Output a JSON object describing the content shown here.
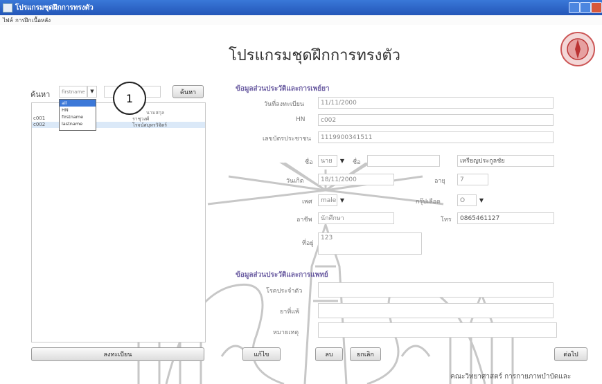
{
  "window": {
    "title": "โปรแกรมชุดฝึกการทรงตัว"
  },
  "menu": [
    "ไฟล์",
    "การฝึก",
    "เนื้อหลัง"
  ],
  "page_title": "โปรแกรมชุดฝึกการทรงตัว",
  "search": {
    "label": "ค้นหา",
    "select_value": "firstname",
    "button": "ค้นหา",
    "options": [
      "all",
      "HN",
      "firstname",
      "lastname"
    ],
    "selected_index": 0
  },
  "results": {
    "header_right": "นามสกุล",
    "rows": [
      {
        "id": "c001",
        "col2": "ราชุวงศ์"
      },
      {
        "id": "c002",
        "col2": "โรจน์สมุทรวิจิตร์"
      }
    ]
  },
  "callout": "1",
  "patient_section": {
    "heading": "ข้อมูลส่วนประวัติและการเพย์ยา",
    "fields": [
      {
        "label": "วันที่ลงทะเบียน",
        "value": "11/11/2000"
      },
      {
        "label": "HN",
        "value": "c002"
      },
      {
        "label": "เลขบัตรประชาชน",
        "value": "1119900341511"
      },
      {
        "label": "ชื่อ",
        "value": "นาย"
      },
      {
        "label": "วันเกิด",
        "value": "18/11/2000"
      },
      {
        "label": "เพศ",
        "value": "male"
      },
      {
        "label": "อาชีพ",
        "value": "นักศึกษา"
      },
      {
        "label": "ที่อยู่",
        "value": "123"
      }
    ],
    "name_sub_label": "นามสกุล",
    "lastname_value": "เหรียญประกูลชัย",
    "age_label": "อายุ",
    "age_value": "7",
    "blood_label": "กรุ๊ปเลือด",
    "blood_value": "O",
    "phone_label": "โทร",
    "phone_value": "0865461127"
  },
  "medical_section": {
    "heading": "ข้อมูลส่วนประวัติและการแพทย์",
    "fields": [
      "โรคประจำตัว",
      "ยาที่แพ้",
      "หมายเหตุ"
    ]
  },
  "buttons": {
    "history": "ลงทะเบียน",
    "save": "แก้ไข",
    "delete": "ลบ",
    "cancel": "ยกเลิก",
    "next": "ต่อไป"
  },
  "footer": "คณะวิทยาศาสตร์ การกายภาพบำบัดและ"
}
